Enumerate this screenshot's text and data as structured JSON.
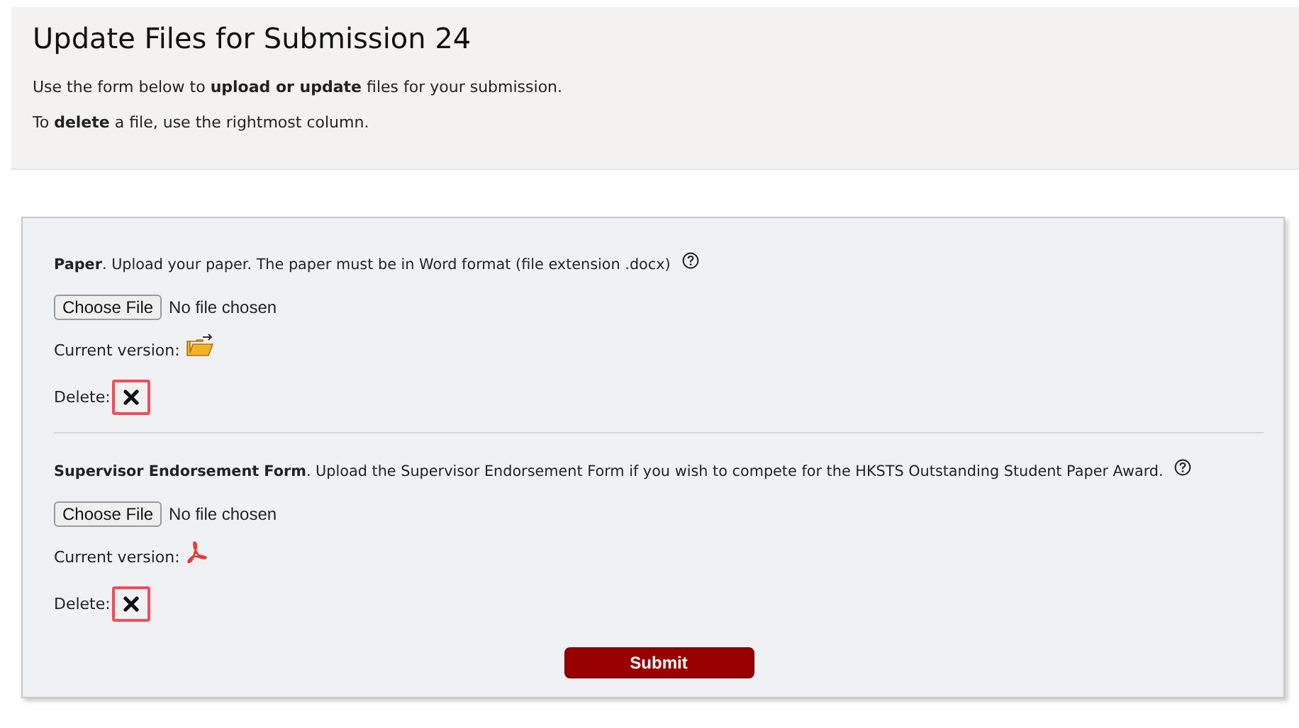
{
  "header": {
    "title": "Update Files for Submission 24",
    "paragraphs": [
      "Use the form below to **upload or update** files for your submission.",
      "To **delete** a file, use the rightmost column."
    ]
  },
  "files": [
    {
      "description": "**Paper**. Upload your paper. The paper must be in Word format (file extension .docx)",
      "choose_button": "Choose File",
      "file_status": "No file chosen",
      "current_label": "Current version:",
      "kind": "folder",
      "delete_label": "Delete:",
      "highlighted": true
    },
    {
      "description": "**Supervisor Endorsement Form**. Upload the Supervisor Endorsement Form if you wish to compete for the HKSTS Outstanding Student Paper Award.",
      "choose_button": "Choose File",
      "file_status": "No file chosen",
      "current_label": "Current version:",
      "kind": "pdf",
      "delete_label": "Delete:",
      "highlighted": true
    }
  ],
  "submit_button": "Submit"
}
